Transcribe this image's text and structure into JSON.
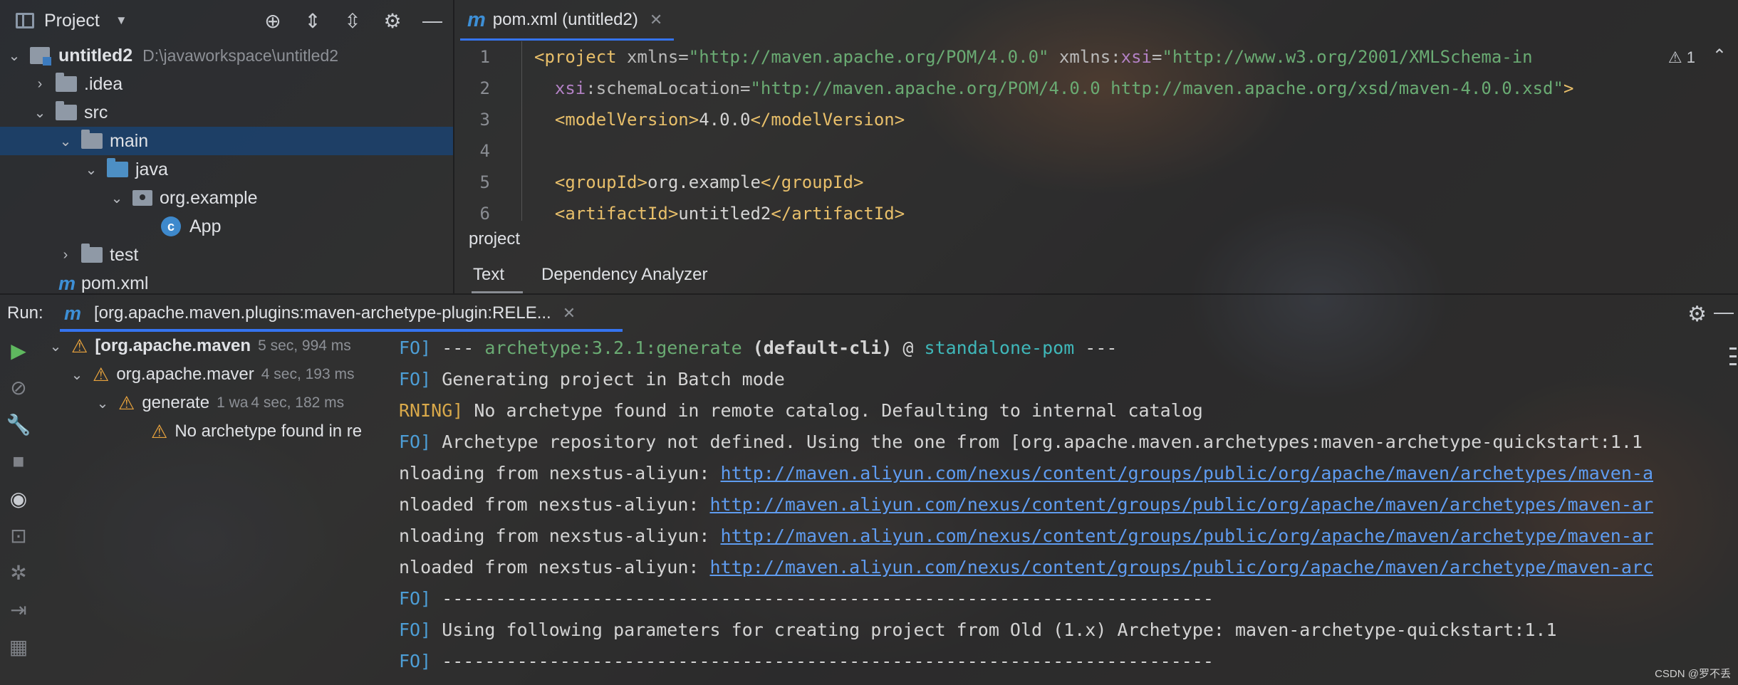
{
  "project_panel": {
    "title": "Project",
    "tree": [
      {
        "label": "untitled2",
        "path": "D:\\javaworkspace\\untitled2"
      },
      {
        "label": ".idea"
      },
      {
        "label": "src"
      },
      {
        "label": "main"
      },
      {
        "label": "java"
      },
      {
        "label": "org.example"
      },
      {
        "label": "App"
      },
      {
        "label": "test"
      },
      {
        "label": "pom.xml"
      }
    ]
  },
  "editor": {
    "tab_label": "pom.xml (untitled2)",
    "warning_count": "1",
    "lines": [
      {
        "num": "1"
      },
      {
        "num": "2"
      },
      {
        "num": "3"
      },
      {
        "num": "4"
      },
      {
        "num": "5"
      },
      {
        "num": "6"
      }
    ],
    "code": {
      "l1_tag_open": "<project",
      "l1_attr1": " xmlns=",
      "l1_val1": "\"http://maven.apache.org/POM/4.0.0\"",
      "l1_attr2": " xmlns:",
      "l1_ns": "xsi",
      "l1_eq": "=",
      "l1_val2": "\"http://www.w3.org/2001/XMLSchema-in",
      "l2_ns": "xsi",
      "l2_attr": ":schemaLocation=",
      "l2_val": "\"http://maven.apache.org/POM/4.0.0 http://maven.apache.org/xsd/maven-4.0.0.xsd\"",
      "l2_close": ">",
      "l3_open": "<modelVersion>",
      "l3_text": "4.0.0",
      "l3_close": "</modelVersion>",
      "l5_open": "<groupId>",
      "l5_text": "org.example",
      "l5_close": "</groupId>",
      "l6_open": "<artifactId>",
      "l6_text": "untitled2",
      "l6_close": "</artifactId>"
    },
    "breadcrumb": "project",
    "bottom_tabs": [
      "Text",
      "Dependency Analyzer"
    ]
  },
  "run": {
    "label": "Run:",
    "tab_label": "[org.apache.maven.plugins:maven-archetype-plugin:RELE...",
    "tree": [
      {
        "label": "[org.apache.maven",
        "time": "5 sec, 994 ms"
      },
      {
        "label": "org.apache.maver",
        "time": "4 sec, 193 ms"
      },
      {
        "label": "generate",
        "extra": "1 wa",
        "time": "4 sec, 182 ms"
      },
      {
        "label": "No archetype found in re"
      }
    ],
    "console": {
      "l1_prefix": "FO]",
      "l1_a": " --- ",
      "l1_goal": "archetype:3.2.1:generate",
      "l1_b": " (default-cli)",
      "l1_c": " @ ",
      "l1_proj": "standalone-pom",
      "l1_d": " ---",
      "l2_prefix": "FO]",
      "l2_text": " Generating project in Batch mode",
      "l3_prefix": "RNING]",
      "l3_text": " No archetype found in remote catalog. Defaulting to internal catalog",
      "l4_prefix": "FO]",
      "l4_text": " Archetype repository not defined. Using the one from [org.apache.maven.archetypes:maven-archetype-quickstart:1.1",
      "l5_text": "nloading from nexstus-aliyun: ",
      "l5_link": "http://maven.aliyun.com/nexus/content/groups/public/org/apache/maven/archetypes/maven-a",
      "l6_text": "nloaded from nexstus-aliyun: ",
      "l6_link": "http://maven.aliyun.com/nexus/content/groups/public/org/apache/maven/archetypes/maven-ar",
      "l7_text": "nloading from nexstus-aliyun: ",
      "l7_link": "http://maven.aliyun.com/nexus/content/groups/public/org/apache/maven/archetype/maven-ar",
      "l8_text": "nloaded from nexstus-aliyun: ",
      "l8_link": "http://maven.aliyun.com/nexus/content/groups/public/org/apache/maven/archetype/maven-arc",
      "l9_prefix": "FO]",
      "l9_text": " ------------------------------------------------------------------------",
      "l10_prefix": "FO]",
      "l10_text": " Using following parameters for creating project from Old (1.x) Archetype: maven-archetype-quickstart:1.1",
      "l11_prefix": "FO]",
      "l11_text": " ------------------------------------------------------------------------"
    }
  },
  "watermark": "CSDN @罗不丢",
  "colors": {
    "accent": "#3574f0",
    "selection": "#1b4270",
    "warning": "#e8a33d",
    "link": "#5f9cf0"
  }
}
